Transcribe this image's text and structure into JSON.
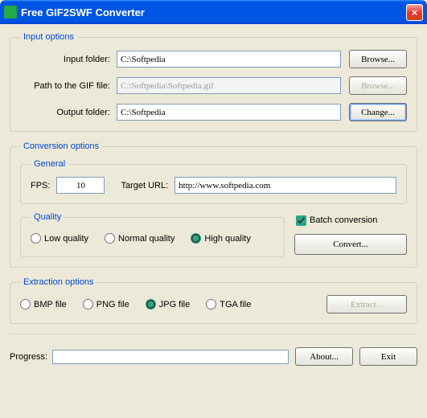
{
  "window": {
    "title": "Free GIF2SWF Converter"
  },
  "input_options": {
    "legend": "Input options",
    "input_folder_label": "Input folder:",
    "input_folder_value": "C:\\Softpedia",
    "gif_path_label": "Path to the GIF file:",
    "gif_path_value": "C:\\Softpedia\\Softpedia.gif",
    "output_folder_label": "Output folder:",
    "output_folder_value": "C:\\Softpedia",
    "browse": "Browse...",
    "change": "Change..."
  },
  "conversion_options": {
    "legend": "Conversion options",
    "general_legend": "General",
    "fps_label": "FPS:",
    "fps_value": "10",
    "target_url_label": "Target URL:",
    "target_url_value": "http://www.softpedia.com",
    "quality_legend": "Quality",
    "quality_low": "Low quality",
    "quality_normal": "Normal quality",
    "quality_high": "High quality",
    "batch_label": "Batch conversion",
    "convert": "Convert..."
  },
  "extraction_options": {
    "legend": "Extraction options",
    "bmp": "BMP file",
    "png": "PNG file",
    "jpg": "JPG file",
    "tga": "TGA file",
    "extract": "Extract..."
  },
  "footer": {
    "progress_label": "Progress:",
    "about": "About...",
    "exit": "Exit"
  }
}
